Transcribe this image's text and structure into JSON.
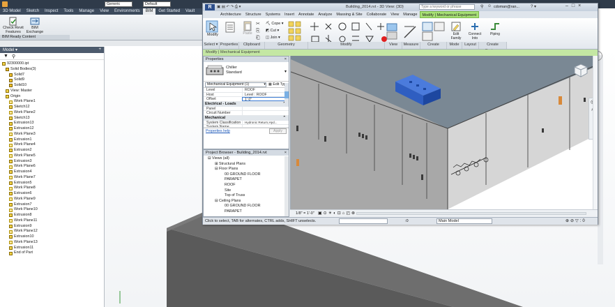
{
  "inventor": {
    "quick_access": {
      "style_value": "Generic",
      "appearance_value": "Default"
    },
    "tabs": [
      "3D Model",
      "Sketch",
      "Inspect",
      "Tools",
      "Manage",
      "View",
      "Environments",
      "BIM",
      "Get Started",
      "Vault"
    ],
    "ribbon": {
      "check_label": "Check Revit Features",
      "bim_exchange_label": "BIM Exchange",
      "group_label": "BIM Ready Content"
    },
    "browser": {
      "title": "Model ▾",
      "items": [
        "92300000.ipt",
        "Solid Bodies(3)",
        "Solid7",
        "Solid9",
        "Solid10",
        "View: Master",
        "Origin",
        "Work Plane1",
        "Sketch12",
        "Work Plane2",
        "Sketch13",
        "Extrusion13",
        "Extrusion12",
        "Work Plane3",
        "Extrusion1",
        "Work Plane4",
        "Extrusion2",
        "Work Plane5",
        "Extrusion3",
        "Work Plane6",
        "Extrusion4",
        "Work Plane7",
        "Extrusion5",
        "Work Plane8",
        "Extrusion6",
        "Work Plane9",
        "Extrusion7",
        "Work Plane10",
        "Extrusion8",
        "Work Plane11",
        "Extrusion9",
        "Work Plane12",
        "Extrusion10",
        "Work Plane13",
        "Extrusion11",
        "End of Part"
      ]
    }
  },
  "revit": {
    "title": "Building_2014.rvt - 3D View: {3D}",
    "search_placeholder": "Type a keyword or phrase",
    "user": "cdoman@ran...",
    "tabs": [
      "Architecture",
      "Structure",
      "Systems",
      "Insert",
      "Annotate",
      "Analyze",
      "Massing & Site",
      "Collaborate",
      "View",
      "Manage",
      "Modify | Mechanical Equipment"
    ],
    "ribbon_buttons": {
      "modify": "Modify",
      "paste": "Paste",
      "cope": "Cope",
      "cut": "Cut",
      "join": "Join",
      "edit_family": "Edit Family",
      "connect_into": "Connect Into",
      "piping": "Piping"
    },
    "groups": [
      "Select ▾",
      "Properties",
      "Clipboard",
      "Geometry",
      "Modify",
      "View",
      "Measure",
      "Create",
      "Mode",
      "Layout",
      "Create Systems"
    ],
    "context_label": "Modify | Mechanical Equipment",
    "properties": {
      "title": "Properties",
      "type_name": "Chiller",
      "type_sub": "Standard",
      "selector": "Mechanical Equipment (1)",
      "edit_type": "Edit Type",
      "rows": [
        {
          "k": "Level",
          "v": "ROOF"
        },
        {
          "k": "Host",
          "v": "Level : ROOF"
        },
        {
          "k": "Offset",
          "v": "1' 0\""
        }
      ],
      "cat_electrical": "Electrical - Loads",
      "rows2": [
        {
          "k": "Panel",
          "v": ""
        },
        {
          "k": "Circuit Number",
          "v": ""
        }
      ],
      "cat_mechanical": "Mechanical",
      "rows3": [
        {
          "k": "System Classification",
          "v": "Hydronic Return,Hyd..."
        },
        {
          "k": "System Name",
          "v": ""
        }
      ],
      "help": "Properties help",
      "apply": "Apply"
    },
    "project_browser": {
      "title": "Project Browser - Building_2014.rvt",
      "items": [
        "Views (all)",
        "Structural Plans",
        "Floor Plans",
        "00 GROUND FLOOR",
        "PARAPET",
        "ROOF",
        "Site",
        "Top of Truss",
        "Ceiling Plans",
        "00 GROUND FLOOR",
        "PARAPET"
      ]
    },
    "view_scale": "1/8\" = 1'-0\"",
    "status_text": "Click to select, TAB for alternates, CTRL adds, SHIFT unselects.",
    "status_count": ":0",
    "model_dropdown": "Main Model"
  }
}
